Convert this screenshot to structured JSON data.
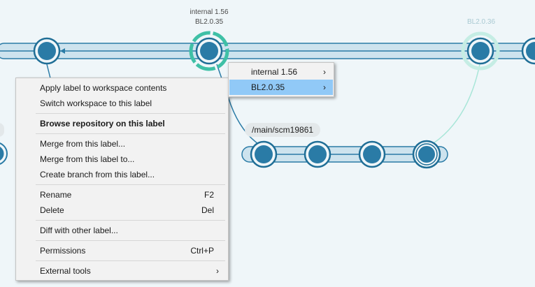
{
  "graph": {
    "node_labels": [
      {
        "lines": [
          "internal 1.56",
          "BL2.0.35"
        ],
        "faded": false
      },
      {
        "lines": [
          "BL2.0.36"
        ],
        "faded": true
      }
    ],
    "branch_label": "/main/scm19861",
    "colors": {
      "node_fill": "#2a7ba6",
      "node_ring": "#1f6e96",
      "branch_bar": "#cde3ee",
      "selected_ring": "#3fc0a6",
      "faded_ring": "#c5ede4",
      "background": "#eff6f9"
    }
  },
  "context_menu": {
    "items": [
      {
        "label": "Apply label to workspace contents",
        "shortcut": "",
        "submenu": false,
        "bold": false
      },
      {
        "label": "Switch workspace to this label",
        "shortcut": "",
        "submenu": false,
        "bold": false
      },
      {
        "label": "Browse repository on this label",
        "shortcut": "",
        "submenu": false,
        "bold": true
      },
      {
        "label": "Merge from this label...",
        "shortcut": "",
        "submenu": false,
        "bold": false
      },
      {
        "label": "Merge from this label to...",
        "shortcut": "",
        "submenu": false,
        "bold": false
      },
      {
        "label": "Create branch from this label...",
        "shortcut": "",
        "submenu": false,
        "bold": false
      },
      {
        "label": "Rename",
        "shortcut": "F2",
        "submenu": false,
        "bold": false
      },
      {
        "label": "Delete",
        "shortcut": "Del",
        "submenu": false,
        "bold": false
      },
      {
        "label": "Diff with other label...",
        "shortcut": "",
        "submenu": false,
        "bold": false
      },
      {
        "label": "Permissions",
        "shortcut": "Ctrl+P",
        "submenu": false,
        "bold": false
      },
      {
        "label": "External tools",
        "shortcut": "",
        "submenu": true,
        "bold": false
      }
    ]
  },
  "label_submenu": {
    "items": [
      {
        "label": "internal 1.56",
        "selected": false
      },
      {
        "label": "BL2.0.35",
        "selected": true
      }
    ],
    "arrow": "›"
  }
}
